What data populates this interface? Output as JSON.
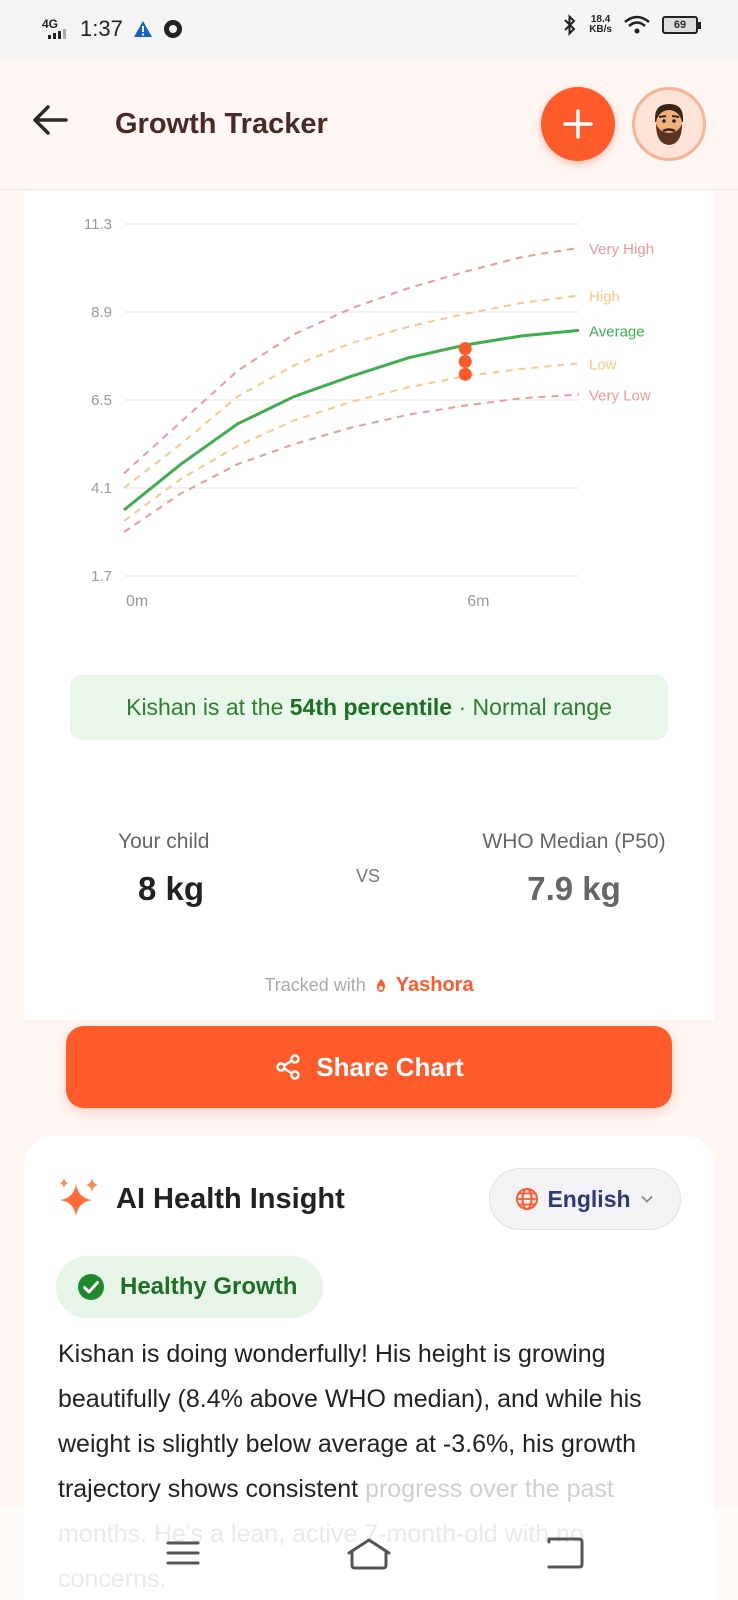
{
  "status_bar": {
    "network": "4G",
    "time": "1:37",
    "speed_value": "18.4",
    "speed_unit": "KB/s",
    "battery": "69"
  },
  "header": {
    "title": "Growth Tracker",
    "back_icon": "arrow-left-icon",
    "add_icon": "plus-icon",
    "avatar_icon": "bearded-man-avatar"
  },
  "chart_data": {
    "type": "line",
    "x": [
      0,
      1,
      2,
      3,
      4,
      5,
      6,
      7,
      8
    ],
    "xticks": [
      "0m",
      "6m"
    ],
    "xtick_values": [
      0,
      6
    ],
    "yticks": [
      "11.3",
      "8.9",
      "6.5",
      "4.1",
      "1.7"
    ],
    "ylim": [
      1.7,
      11.3
    ],
    "grid": true,
    "series": [
      {
        "name": "Very High",
        "style": "dashed",
        "color": "#ef9a9a",
        "values": [
          4.5,
          5.9,
          7.3,
          8.3,
          9.0,
          9.55,
          10.0,
          10.4,
          10.65
        ]
      },
      {
        "name": "High",
        "style": "dashed",
        "color": "#f7c98a",
        "values": [
          4.1,
          5.3,
          6.6,
          7.45,
          8.05,
          8.5,
          8.85,
          9.15,
          9.35
        ]
      },
      {
        "name": "Average",
        "style": "solid",
        "color": "#3fae4d",
        "values": [
          3.5,
          4.75,
          5.85,
          6.6,
          7.15,
          7.65,
          8.0,
          8.25,
          8.4
        ]
      },
      {
        "name": "Low",
        "style": "dashed",
        "color": "#f7c98a",
        "values": [
          3.2,
          4.35,
          5.25,
          5.95,
          6.45,
          6.85,
          7.15,
          7.35,
          7.5
        ]
      },
      {
        "name": "Very Low",
        "style": "dashed",
        "color": "#ef9a9a",
        "values": [
          2.9,
          3.95,
          4.75,
          5.3,
          5.75,
          6.1,
          6.35,
          6.55,
          6.65
        ]
      }
    ],
    "markers": {
      "x": 6,
      "values": [
        7.9,
        7.55,
        7.2
      ],
      "color": "#ff5a2a"
    }
  },
  "summary": {
    "prefix": "Kishan is at the ",
    "percentile": "54th percentile",
    "suffix": " · Normal range"
  },
  "comparison": {
    "child_label": "Your child",
    "child_value": "8 kg",
    "vs": "VS",
    "who_label": "WHO Median (P50)",
    "who_value": "7.9 kg"
  },
  "tracked": {
    "text": "Tracked with",
    "brand": "Yashora"
  },
  "share": {
    "label": "Share Chart",
    "icon": "share-icon"
  },
  "insight": {
    "title": "AI Health Insight",
    "icon": "sparkle-icon",
    "language": "English",
    "status": "Healthy Growth",
    "text_main": "Kishan is doing wonderfully! His height is growing beautifully (8.4% above WHO median), and while his weight is slightly below average at -3.6%, his growth trajectory shows consistent",
    "text_faded": "progress over the past months. He's a lean, active 7-month-old with no concerns."
  },
  "colors": {
    "accent": "#ff5a2a",
    "success": "#2e7d32",
    "title": "#4a2a22"
  }
}
